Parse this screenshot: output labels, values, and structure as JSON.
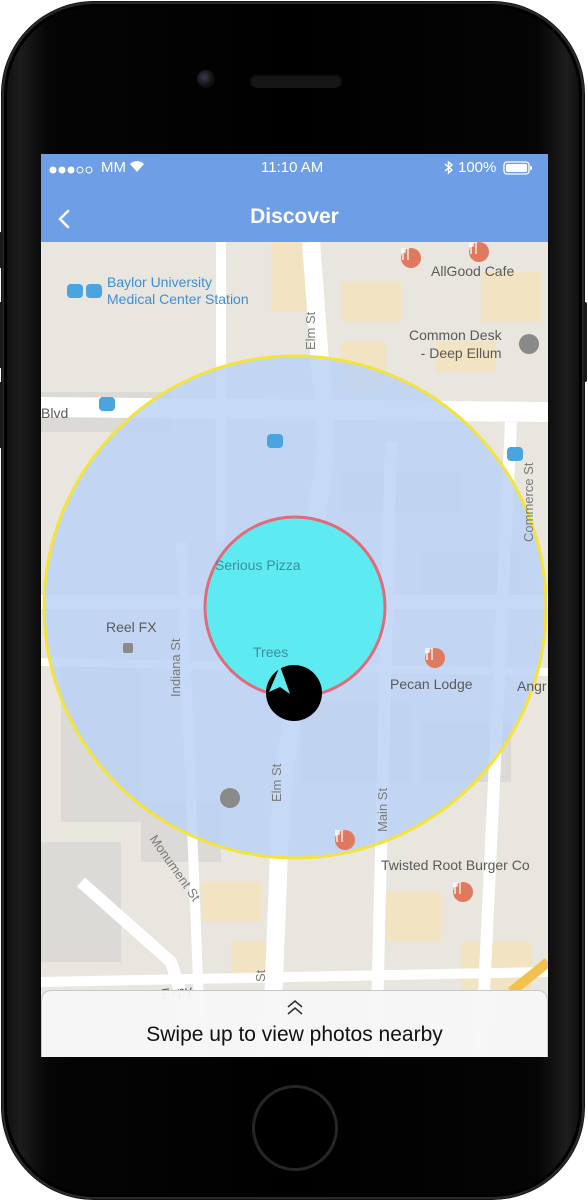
{
  "status_bar": {
    "carrier": "MM",
    "time": "11:10 AM",
    "battery": "100%"
  },
  "nav": {
    "title": "Discover",
    "back_icon": "chevron-left-icon"
  },
  "map": {
    "labels": {
      "baylor_line1": "Baylor University",
      "baylor_line2": "Medical Center Station",
      "allgood": "AllGood Cafe",
      "common_desk_line1": "Common Desk",
      "common_desk_line2": "- Deep Ellum",
      "blvd": "Blvd",
      "serious_pizza": "Serious Pizza",
      "reel_fx": "Reel FX",
      "trees": "Trees",
      "pecan_lodge": "Pecan Lodge",
      "angry": "Angr",
      "twisted_root": "Twisted Root Burger Co",
      "expy": "Expy"
    },
    "streets": {
      "elm_st_top": "Elm St",
      "commerce_st": "Commerce St",
      "indiana_st": "Indiana St",
      "elm_st_bottom": "Elm St",
      "main_st": "Main St",
      "monument_st": "Monument St",
      "bottom_st": "St"
    },
    "colors": {
      "outer_radius_fill": "#b9d2f7",
      "outer_radius_stroke": "#f3e33a",
      "inner_radius_fill": "#5deaf0",
      "inner_radius_stroke": "#e36a7a"
    }
  },
  "swipe": {
    "text": "Swipe up to view photos nearby",
    "icon": "double-chevron-up-icon"
  }
}
